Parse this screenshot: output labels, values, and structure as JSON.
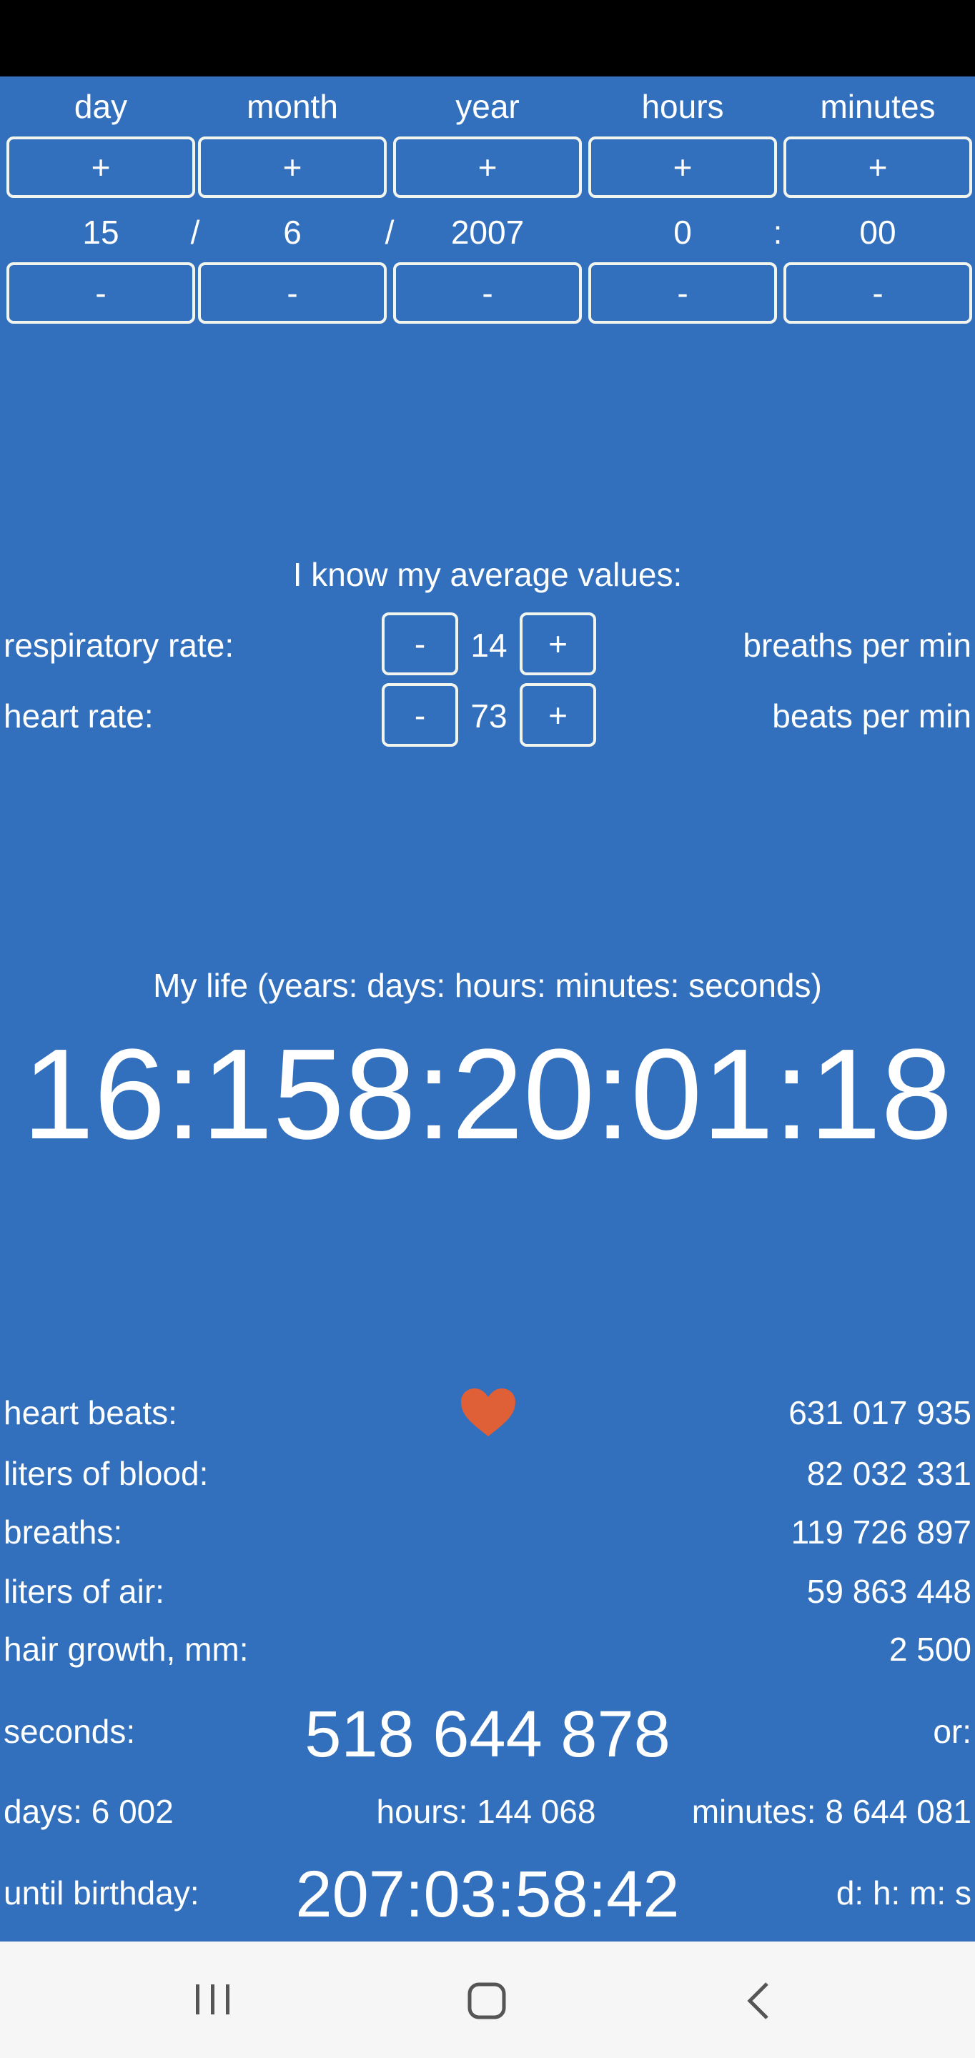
{
  "date_picker": {
    "columns": [
      {
        "label": "day",
        "value": "15",
        "plus": "+",
        "minus": "-"
      },
      {
        "label": "month",
        "value": "6",
        "plus": "+",
        "minus": "-"
      },
      {
        "label": "year",
        "value": "2007",
        "plus": "+",
        "minus": "-"
      },
      {
        "label": "hours",
        "value": "0",
        "plus": "+",
        "minus": "-"
      },
      {
        "label": "minutes",
        "value": "00",
        "plus": "+",
        "minus": "-"
      }
    ],
    "separators": [
      "/",
      "/",
      ":"
    ]
  },
  "averages": {
    "title": "I know my average values:",
    "respiratory": {
      "label": "respiratory rate:",
      "value": "14",
      "minus": "-",
      "plus": "+",
      "unit": "breaths per min"
    },
    "heart": {
      "label": "heart rate:",
      "value": "73",
      "minus": "-",
      "plus": "+",
      "unit": "beats per min"
    }
  },
  "life": {
    "title": "My life (years: days: hours: minutes: seconds)",
    "counter": "16:158:20:01:18"
  },
  "stats": {
    "heart_icon_color": "#df5f37",
    "rows": [
      {
        "label": "heart beats:",
        "value": "631 017 935"
      },
      {
        "label": "liters of blood:",
        "value": "82 032 331"
      },
      {
        "label": "breaths:",
        "value": "119 726 897"
      },
      {
        "label": "liters of air:",
        "value": "59 863 448"
      },
      {
        "label": "hair growth, mm:",
        "value": "2 500"
      }
    ],
    "seconds_label": "seconds:",
    "seconds_value": "518 644 878",
    "or_label": "or:",
    "days": "days: 6 002",
    "hours": "hours: 144 068",
    "minutes": "minutes: 8 644 081",
    "birthday_label": "until birthday:",
    "birthday_value": "207:03:58:42",
    "birthday_format": "d: h: m: s"
  },
  "colors": {
    "background": "#3270be",
    "heart": "#df5f37",
    "nav_bar": "#f6f6f6"
  }
}
